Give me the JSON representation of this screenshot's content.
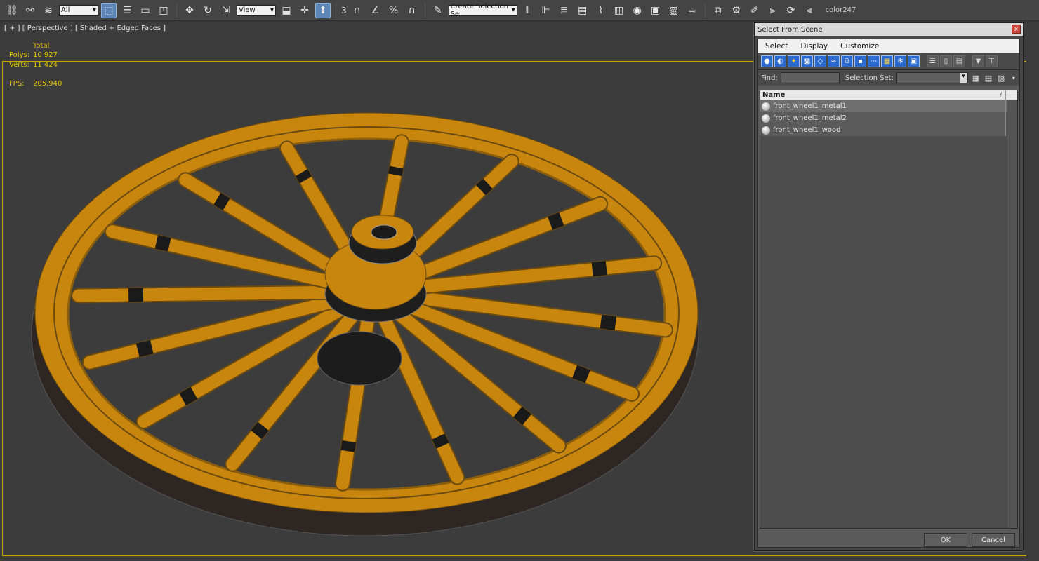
{
  "toolbar": {
    "selection_filter": "All",
    "ref_coord": "View",
    "snap_num": "3",
    "named_selection_placeholder": "Create Selection Se",
    "color_label": "color247"
  },
  "viewport": {
    "label": "[ + ] [ Perspective ] [ Shaded + Edged Faces ]",
    "stats": {
      "total_label": "Total",
      "polys_label": "Polys:",
      "polys_value": "10 927",
      "verts_label": "Verts:",
      "verts_value": "11 424",
      "fps_label": "FPS:",
      "fps_value": "205,940"
    }
  },
  "dialog": {
    "title": "Select From Scene",
    "close": "x",
    "menu": [
      "Select",
      "Display",
      "Customize"
    ],
    "find_label": "Find:",
    "selection_set_label": "Selection Set:",
    "column_name": "Name",
    "sort_indicator": "/",
    "objects": [
      "front_wheel1_metal1",
      "front_wheel1_metal2",
      "front_wheel1_wood"
    ],
    "ok": "OK",
    "cancel": "Cancel"
  },
  "colors": {
    "wood": "#c8860e",
    "tire": "#2e2622",
    "frame_highlight": "#c8a800",
    "stat_text": "#e6c600"
  }
}
